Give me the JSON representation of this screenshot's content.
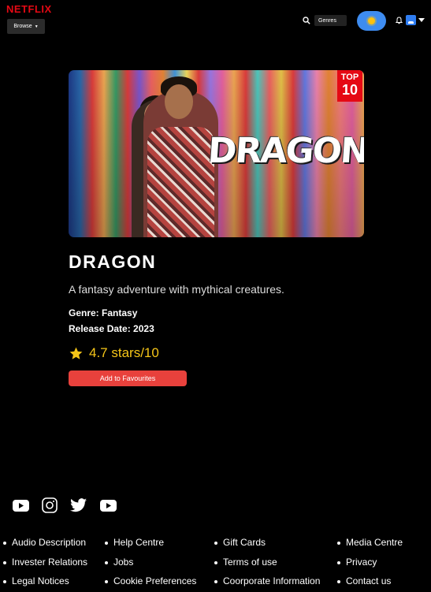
{
  "header": {
    "logo": "NETFLIX",
    "browse_label": "Browse",
    "genres_label": "Genres",
    "icons": [
      "search-icon",
      "sun-icon",
      "bell-icon",
      "avatar",
      "caret-down-icon"
    ]
  },
  "poster": {
    "badge_top": "TOP",
    "badge_num": "10",
    "title_art": "DRAGON"
  },
  "movie": {
    "title": "DRAGON",
    "description": "A fantasy adventure with mythical creatures.",
    "genre": "Genre: Fantasy",
    "release": "Release Date: 2023",
    "rating": "4.7 stars/10",
    "fav_button": "Add to Favourites"
  },
  "footer": {
    "social": [
      "youtube-icon",
      "instagram-icon",
      "twitter-icon",
      "youtube-icon"
    ],
    "col1": [
      "Audio Description",
      "Invester Relations",
      "Legal Notices"
    ],
    "col2": [
      "Help Centre",
      "Jobs",
      "Cookie Preferences"
    ],
    "col3": [
      "Gift Cards",
      "Terms of use",
      "Coorporate Information"
    ],
    "col4": [
      "Media Centre",
      "Privacy",
      "Contact us"
    ]
  },
  "colors": {
    "brand": "#e50914",
    "accent_button": "#e8413c",
    "rating": "#f5c518",
    "toggle": "#3e8cf0"
  }
}
